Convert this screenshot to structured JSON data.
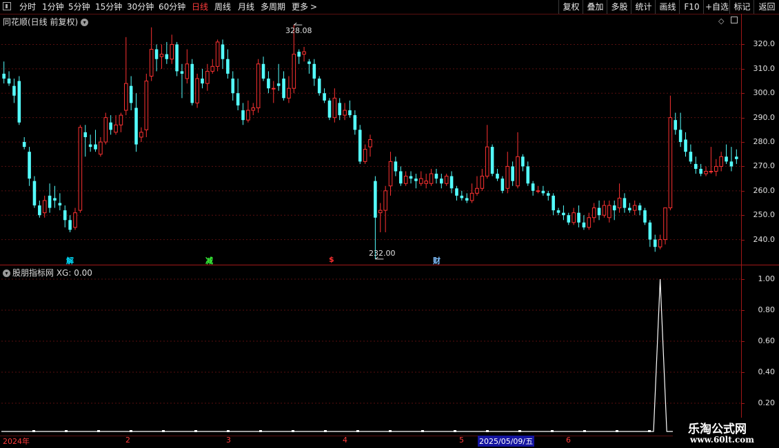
{
  "toolbar": {
    "tabs": [
      {
        "label": "分时",
        "active": false
      },
      {
        "label": "1分钟",
        "active": false
      },
      {
        "label": "5分钟",
        "active": false
      },
      {
        "label": "15分钟",
        "active": false
      },
      {
        "label": "30分钟",
        "active": false
      },
      {
        "label": "60分钟",
        "active": false
      },
      {
        "label": "日线",
        "active": true
      },
      {
        "label": "周线",
        "active": false
      },
      {
        "label": "月线",
        "active": false
      },
      {
        "label": "多周期",
        "active": false
      },
      {
        "label": "更多",
        "active": false
      }
    ],
    "more_arrow": ">",
    "right_buttons": [
      "复权",
      "叠加",
      "多股",
      "统计",
      "画线",
      "F10",
      "+自选",
      "标记",
      "返回"
    ]
  },
  "main_panel": {
    "title": "同花顺(日线 前复权)",
    "high_label": "328.08",
    "low_label": "232.00",
    "y_ticks": [
      "320.0",
      "310.0",
      "300.0",
      "290.0",
      "280.0",
      "270.0",
      "260.0",
      "250.0",
      "240.0"
    ],
    "markers": [
      {
        "text": "解",
        "color": "#00e0ff"
      },
      {
        "text": "减",
        "color": "#3cff3c"
      },
      {
        "text": "$",
        "color": "#ff3030"
      },
      {
        "text": "财",
        "color": "#80c0ff"
      }
    ]
  },
  "indicator_panel": {
    "title": "股朋指标网 XG: 0.00",
    "y_ticks": [
      "1.00",
      "0.80",
      "0.60",
      "0.40",
      "0.20"
    ]
  },
  "x_axis": {
    "labels": [
      "2024年",
      "2",
      "3",
      "4",
      "5",
      "2025/05/09/五",
      "6"
    ]
  },
  "watermark": {
    "title": "乐淘公式网",
    "url": "www.60lt.com"
  },
  "colors": {
    "up": "#ff3232",
    "down": "#54ffff",
    "axis": "#a31818",
    "bg": "#000000"
  },
  "chart_data": {
    "type": "candlestick",
    "ylim": [
      230,
      332
    ],
    "high": 328.08,
    "low": 232.0,
    "candles": [
      [
        308,
        306,
        313,
        304
      ],
      [
        306,
        304,
        309,
        303
      ],
      [
        303,
        299,
        306,
        296
      ],
      [
        305,
        288,
        307,
        287
      ],
      [
        280,
        278,
        282,
        277
      ],
      [
        276,
        265,
        278,
        262
      ],
      [
        264,
        254,
        266,
        253
      ],
      [
        254,
        250,
        256,
        249
      ],
      [
        251,
        256,
        258,
        249
      ],
      [
        258,
        253,
        263,
        251
      ],
      [
        257,
        256,
        262,
        253
      ],
      [
        255,
        254,
        259,
        252
      ],
      [
        252,
        248,
        254,
        245
      ],
      [
        248,
        244,
        250,
        243
      ],
      [
        245,
        251,
        253,
        244
      ],
      [
        252,
        286,
        287,
        251
      ],
      [
        284,
        282,
        287,
        274
      ],
      [
        279,
        278,
        283,
        276
      ],
      [
        279,
        277,
        285,
        276
      ],
      [
        275,
        280,
        282,
        274
      ],
      [
        280,
        290,
        292,
        279
      ],
      [
        288,
        285,
        291,
        283
      ],
      [
        284,
        287,
        291,
        283
      ],
      [
        287,
        291,
        292,
        284
      ],
      [
        293,
        304,
        323,
        291
      ],
      [
        303,
        296,
        307,
        293
      ],
      [
        294,
        279,
        300,
        276
      ],
      [
        282,
        284,
        286,
        280
      ],
      [
        285,
        305,
        308,
        282
      ],
      [
        307,
        318,
        327,
        305
      ],
      [
        318,
        314,
        320,
        309
      ],
      [
        315,
        316,
        320,
        310
      ],
      [
        316,
        314,
        321,
        312
      ],
      [
        314,
        320,
        324,
        312
      ],
      [
        320,
        309,
        321,
        307
      ],
      [
        309,
        308,
        312,
        298
      ],
      [
        306,
        312,
        318,
        304
      ],
      [
        312,
        296,
        314,
        295
      ],
      [
        296,
        306,
        308,
        294
      ],
      [
        306,
        304,
        310,
        302
      ],
      [
        304,
        309,
        312,
        301
      ],
      [
        309,
        311,
        314,
        308
      ],
      [
        311,
        321,
        322,
        309
      ],
      [
        320,
        314,
        322,
        310
      ],
      [
        314,
        308,
        318,
        306
      ],
      [
        306,
        300,
        309,
        297
      ],
      [
        300,
        295,
        306,
        293
      ],
      [
        293,
        289,
        296,
        287
      ],
      [
        289,
        293,
        297,
        288
      ],
      [
        293,
        294,
        296,
        291
      ],
      [
        294,
        312,
        314,
        292
      ],
      [
        312,
        306,
        315,
        305
      ],
      [
        306,
        302,
        309,
        300
      ],
      [
        302,
        302,
        305,
        296
      ],
      [
        304,
        303,
        312,
        301
      ],
      [
        306,
        298,
        309,
        297
      ],
      [
        298,
        302,
        307,
        296
      ],
      [
        302,
        316,
        328,
        300
      ],
      [
        317,
        315,
        318,
        312
      ],
      [
        316,
        317,
        319,
        313
      ],
      [
        313,
        312,
        314,
        308
      ],
      [
        312,
        306,
        314,
        303
      ],
      [
        306,
        300,
        307,
        299
      ],
      [
        300,
        297,
        302,
        296
      ],
      [
        297,
        290,
        298,
        289
      ],
      [
        290,
        298,
        302,
        288
      ],
      [
        296,
        291,
        298,
        289
      ],
      [
        291,
        293,
        296,
        289
      ],
      [
        293,
        291,
        297,
        290
      ],
      [
        291,
        285,
        293,
        283
      ],
      [
        285,
        272,
        287,
        271
      ],
      [
        272,
        277,
        279,
        271
      ],
      [
        278,
        281,
        283,
        274
      ],
      [
        264,
        249,
        266,
        232
      ],
      [
        251,
        252,
        255,
        243
      ],
      [
        252,
        260,
        262,
        243
      ],
      [
        262,
        272,
        276,
        258
      ],
      [
        272,
        268,
        274,
        266
      ],
      [
        268,
        263,
        270,
        262
      ],
      [
        263,
        266,
        268,
        262
      ],
      [
        266,
        265,
        268,
        263
      ],
      [
        265,
        264,
        267,
        261
      ],
      [
        263,
        265,
        268,
        262
      ],
      [
        263,
        264,
        267,
        261
      ],
      [
        263,
        267,
        269,
        262
      ],
      [
        267,
        265,
        269,
        263
      ],
      [
        265,
        263,
        267,
        261
      ],
      [
        263,
        266,
        267,
        262
      ],
      [
        266,
        261,
        268,
        259
      ],
      [
        261,
        258,
        262,
        256
      ],
      [
        258,
        257,
        260,
        256
      ],
      [
        257,
        256,
        259,
        255
      ],
      [
        256,
        259,
        263,
        255
      ],
      [
        259,
        261,
        266,
        258
      ],
      [
        261,
        266,
        269,
        260
      ],
      [
        266,
        278,
        287,
        265
      ],
      [
        278,
        267,
        279,
        266
      ],
      [
        267,
        265,
        269,
        264
      ],
      [
        265,
        260,
        266,
        259
      ],
      [
        261,
        270,
        276,
        259
      ],
      [
        270,
        264,
        272,
        262
      ],
      [
        262,
        274,
        284,
        261
      ],
      [
        274,
        270,
        275,
        268
      ],
      [
        270,
        263,
        272,
        262
      ],
      [
        263,
        260,
        264,
        258
      ],
      [
        260,
        260,
        262,
        259
      ],
      [
        260,
        259,
        262,
        258
      ],
      [
        259,
        258,
        260,
        256
      ],
      [
        258,
        252,
        259,
        250
      ],
      [
        252,
        251,
        253,
        250
      ],
      [
        251,
        250,
        254,
        248
      ],
      [
        250,
        247,
        251,
        246
      ],
      [
        247,
        251,
        253,
        246
      ],
      [
        251,
        247,
        254,
        245
      ],
      [
        247,
        245,
        250,
        244
      ],
      [
        245,
        249,
        251,
        244
      ],
      [
        249,
        253,
        255,
        247
      ],
      [
        253,
        250,
        256,
        248
      ],
      [
        250,
        254,
        256,
        249
      ],
      [
        249,
        254,
        256,
        247
      ],
      [
        254,
        252,
        256,
        248
      ],
      [
        253,
        257,
        263,
        251
      ],
      [
        257,
        253,
        259,
        251
      ],
      [
        253,
        252,
        255,
        251
      ],
      [
        252,
        254,
        256,
        250
      ],
      [
        254,
        252,
        255,
        250
      ],
      [
        252,
        247,
        253,
        246
      ],
      [
        247,
        240,
        248,
        237
      ],
      [
        240,
        237,
        242,
        235
      ],
      [
        237,
        240,
        242,
        236
      ],
      [
        240,
        253,
        253,
        238
      ],
      [
        253,
        290,
        299,
        252
      ],
      [
        289,
        285,
        292,
        283
      ],
      [
        285,
        280,
        292,
        278
      ],
      [
        281,
        276,
        284,
        274
      ],
      [
        276,
        272,
        279,
        271
      ],
      [
        271,
        269,
        274,
        267
      ],
      [
        269,
        267,
        271,
        266
      ],
      [
        267,
        268,
        270,
        266
      ],
      [
        268,
        268,
        278,
        267
      ],
      [
        268,
        270,
        273,
        266
      ],
      [
        270,
        274,
        276,
        268
      ],
      [
        274,
        272,
        279,
        271
      ],
      [
        272,
        270,
        278,
        268
      ],
      [
        274,
        273,
        277,
        271
      ]
    ],
    "indicator": {
      "name": "XG",
      "value": 0.0,
      "spike_value": 1.0,
      "spike_index": 129,
      "ylim": [
        0,
        1.0
      ]
    }
  }
}
